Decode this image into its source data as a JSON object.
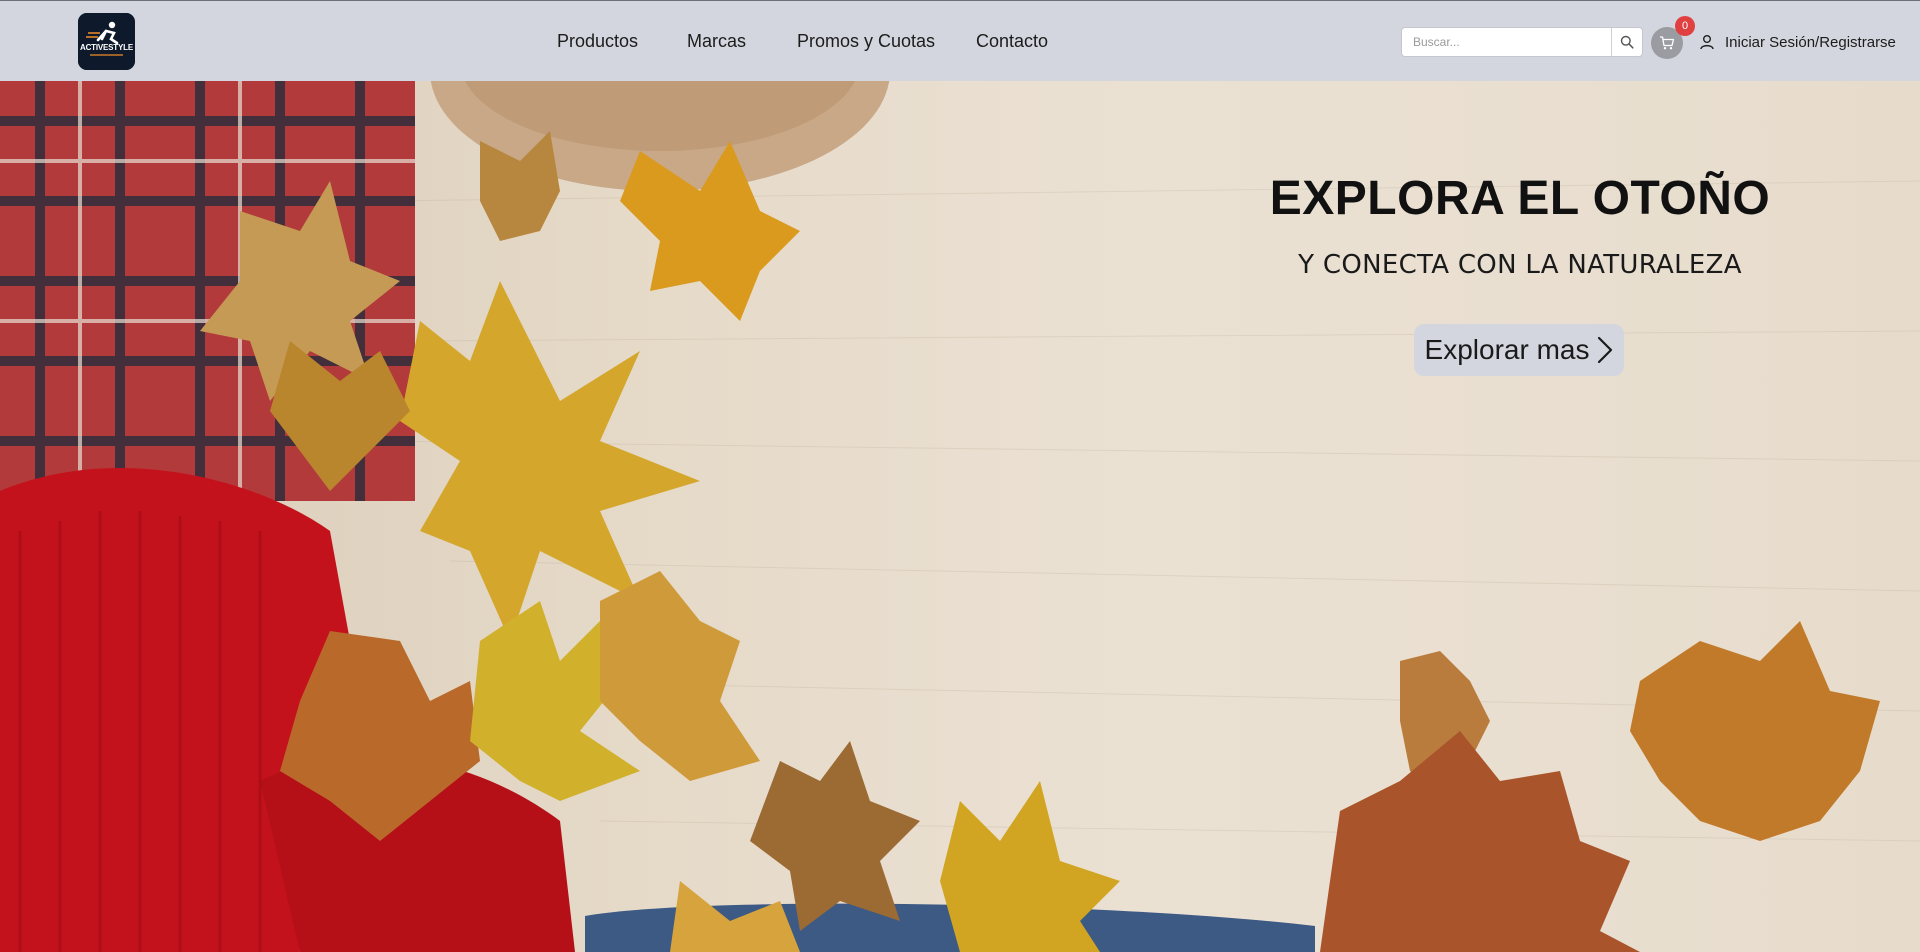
{
  "brand": {
    "logo_text": "ACTIVESTYLE"
  },
  "nav": {
    "items": [
      {
        "label": "Productos"
      },
      {
        "label": "Marcas"
      },
      {
        "label": "Promos y Cuotas"
      },
      {
        "label": "Contacto"
      }
    ]
  },
  "search": {
    "placeholder": "Buscar...",
    "value": "",
    "icon": "search-icon"
  },
  "cart": {
    "count": "0",
    "icon": "cart-icon"
  },
  "account": {
    "label": "Iniciar Sesión/Registrarse",
    "icon": "user-icon"
  },
  "hero": {
    "title": "EXPLORA EL OTOÑO",
    "subtitle": "Y CONECTA CON LA NATURALEZA",
    "cta_label": "Explorar mas",
    "cta_icon": "chevron-right-icon"
  },
  "colors": {
    "navbar_bg": "#d3d6de",
    "cta_bg": "#d3d6de",
    "badge": "#e04040",
    "logo_bg": "#0e1a2b"
  }
}
